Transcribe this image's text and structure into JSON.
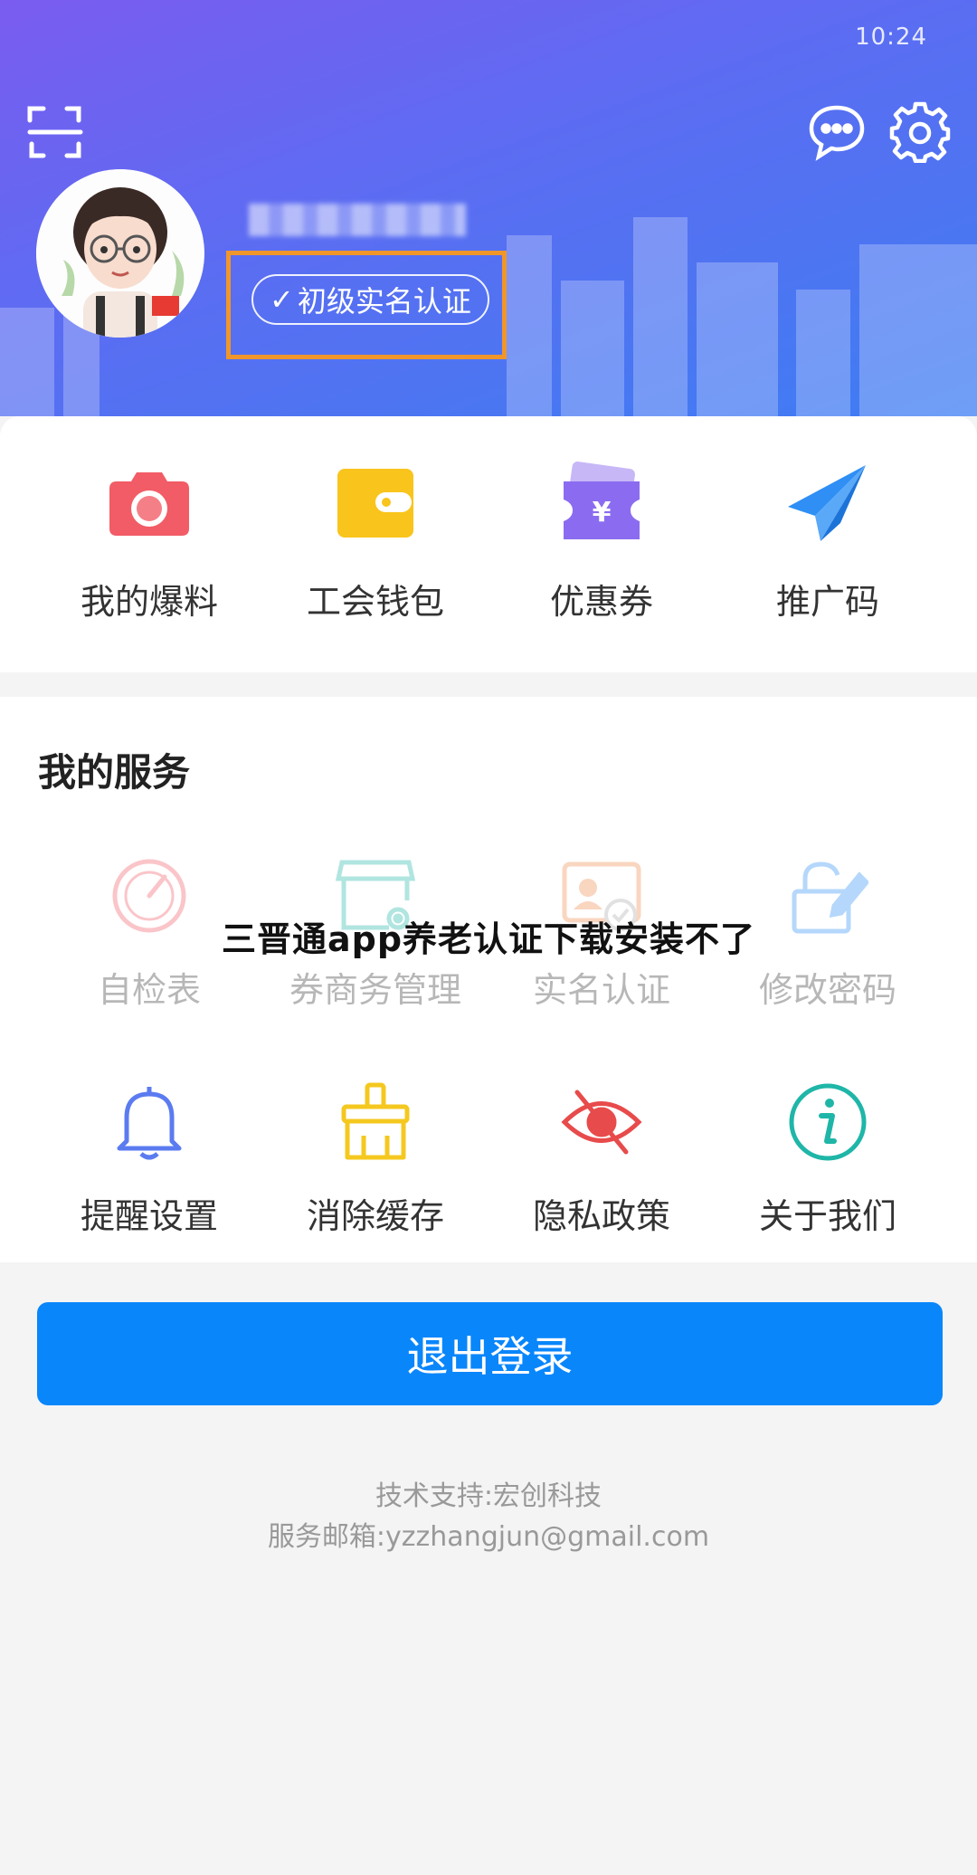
{
  "status_bar": {
    "time": "10:24"
  },
  "header": {
    "scan_icon": "scan-icon",
    "message_icon": "chat-bubble-icon",
    "settings_icon": "gear-icon",
    "verify_check": "✓",
    "verify_label": "初级实名认证",
    "highlight_color": "#f0962a"
  },
  "quick_actions": [
    {
      "label": "我的爆料",
      "icon": "camera-icon",
      "color": "#f25c66"
    },
    {
      "label": "工会钱包",
      "icon": "wallet-icon",
      "color": "#f9c41c"
    },
    {
      "label": "优惠券",
      "icon": "coupon-icon",
      "color": "#8b6cf0"
    },
    {
      "label": "推广码",
      "icon": "paper-plane-icon",
      "color": "#2f8ff5"
    }
  ],
  "services": {
    "title": "我的服务",
    "items": [
      {
        "label": "自检表",
        "icon": "gauge-icon",
        "color": "#f25c66"
      },
      {
        "label": "券商务管理",
        "icon": "store-settings-icon",
        "color": "#1fb6a8"
      },
      {
        "label": "实名认证",
        "icon": "id-card-icon",
        "color": "#f08b4c"
      },
      {
        "label": "修改密码",
        "icon": "lock-edit-icon",
        "color": "#2f8ff5"
      },
      {
        "label": "提醒设置",
        "icon": "bell-icon",
        "color": "#5b7bf0"
      },
      {
        "label": "消除缓存",
        "icon": "broom-icon",
        "color": "#f5c81f"
      },
      {
        "label": "隐私政策",
        "icon": "eye-off-icon",
        "color": "#e84b4b"
      },
      {
        "label": "关于我们",
        "icon": "info-icon",
        "color": "#1fb6a8"
      }
    ]
  },
  "overlay_title": "三晋通app养老认证下载安装不了",
  "logout_label": "退出登录",
  "footer": {
    "support": "技术支持:宏创科技",
    "email": "服务邮箱:yzzhangjun@gmail.com"
  },
  "colors": {
    "header_start": "#7a5cf0",
    "header_end": "#3e7df3",
    "primary": "#0a86fb"
  }
}
